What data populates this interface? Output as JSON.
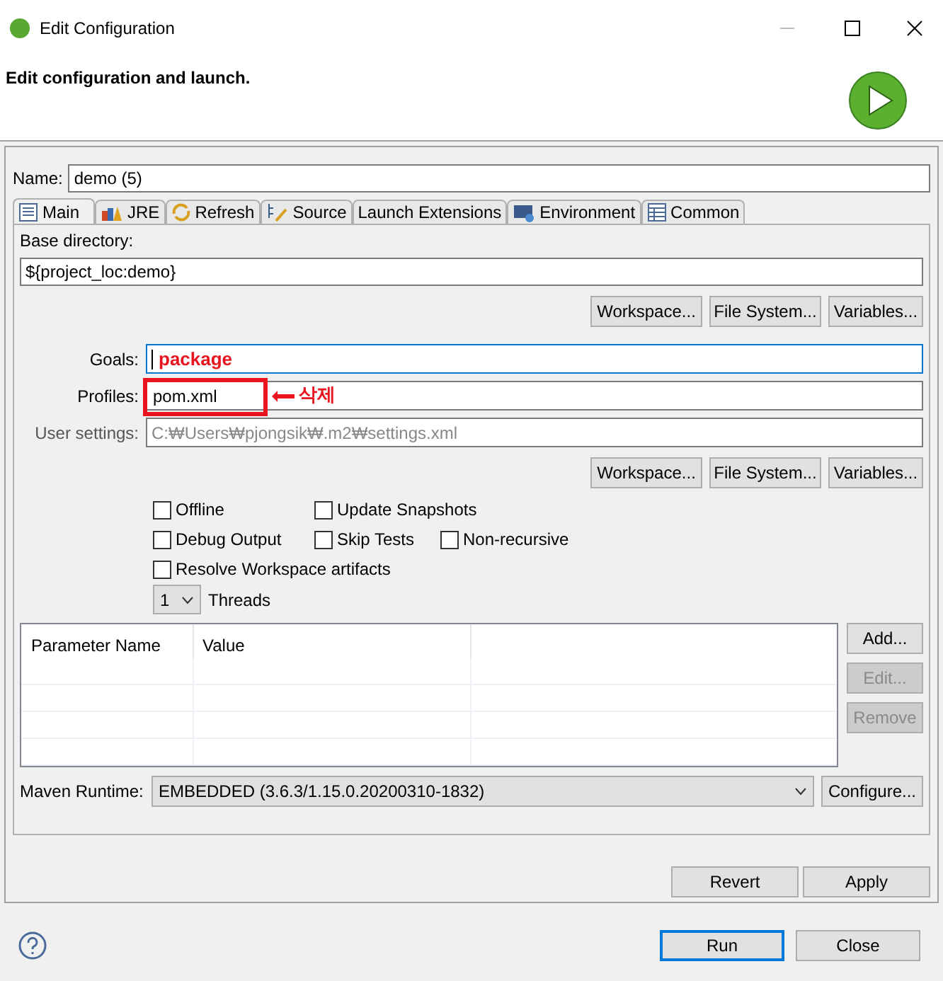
{
  "window": {
    "title": "Edit Configuration"
  },
  "header": {
    "title": "Edit configuration and launch."
  },
  "name": {
    "label": "Name:",
    "value": "demo (5)"
  },
  "tabs": [
    {
      "label": "Main",
      "selected": true,
      "kind": "page"
    },
    {
      "label": "JRE",
      "selected": false,
      "kind": "books"
    },
    {
      "label": "Refresh",
      "selected": false,
      "kind": "refresh"
    },
    {
      "label": "Source",
      "selected": false,
      "kind": "source"
    },
    {
      "label": "Launch Extensions",
      "selected": false,
      "kind": "none"
    },
    {
      "label": "Environment",
      "selected": false,
      "kind": "env"
    },
    {
      "label": "Common",
      "selected": false,
      "kind": "table"
    }
  ],
  "base_directory": {
    "label": "Base directory:",
    "value": "${project_loc:demo}",
    "buttons": [
      "Workspace...",
      "File System...",
      "Variables..."
    ]
  },
  "goals": {
    "label": "Goals:",
    "focused": true,
    "annotation": "package"
  },
  "profiles": {
    "label": "Profiles:",
    "value": "pom.xml",
    "annotation": "삭제"
  },
  "user_settings": {
    "label": "User settings:",
    "placeholder": "C:₩Users₩pjongsik₩.m2₩settings.xml",
    "buttons": [
      "Workspace...",
      "File System...",
      "Variables..."
    ]
  },
  "options": [
    [
      {
        "label": "Offline",
        "checked": false
      },
      {
        "label": "Update Snapshots",
        "checked": false
      }
    ],
    [
      {
        "label": "Debug Output",
        "checked": false
      },
      {
        "label": "Skip Tests",
        "checked": false
      },
      {
        "label": "Non-recursive",
        "checked": false
      }
    ],
    [
      {
        "label": "Resolve Workspace artifacts",
        "checked": false
      }
    ]
  ],
  "threads": {
    "value": "1",
    "label": "Threads"
  },
  "parameters": {
    "columns": [
      "Parameter Name",
      "Value"
    ],
    "buttons": [
      {
        "label": "Add...",
        "disabled": false
      },
      {
        "label": "Edit...",
        "disabled": true
      },
      {
        "label": "Remove",
        "disabled": true
      }
    ]
  },
  "maven_runtime": {
    "label": "Maven Runtime:",
    "value": "EMBEDDED (3.6.3/1.15.0.20200310-1832)",
    "button": "Configure..."
  },
  "actions": [
    "Revert",
    "Apply"
  ],
  "footer": {
    "buttons": [
      {
        "label": "Run",
        "default": true
      },
      {
        "label": "Close",
        "default": false
      }
    ]
  }
}
